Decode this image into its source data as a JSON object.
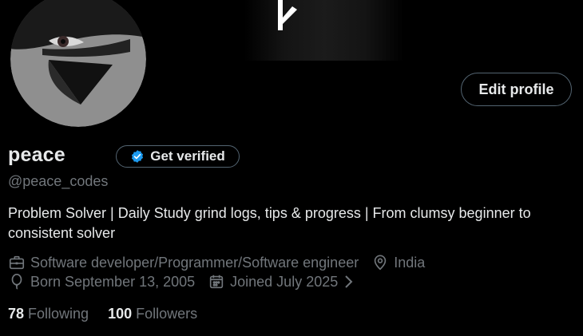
{
  "profile": {
    "name": "peace",
    "handle": "@peace_codes",
    "bio": "Problem Solver | Daily Study grind logs, tips & progress | From clumsy beginner to consistent solver",
    "profession": "Software developer/Programmer/Software engineer",
    "location": "India",
    "birthday": "Born September 13, 2005",
    "joined": "Joined July 2025"
  },
  "buttons": {
    "edit_profile": "Edit profile",
    "get_verified": "Get verified"
  },
  "stats": {
    "following_count": "78",
    "following_label": "Following",
    "followers_count": "100",
    "followers_label": "Followers"
  },
  "icons": {
    "verified": "verified-badge-icon",
    "profession": "briefcase-icon",
    "location": "location-pin-icon",
    "birthday": "balloon-icon",
    "joined": "calendar-icon",
    "expand": "chevron-right-icon"
  },
  "colors": {
    "background": "#000000",
    "text_primary": "#e7e9ea",
    "text_secondary": "#71767b",
    "border": "#536471",
    "verified_blue": "#1d9bf0"
  }
}
